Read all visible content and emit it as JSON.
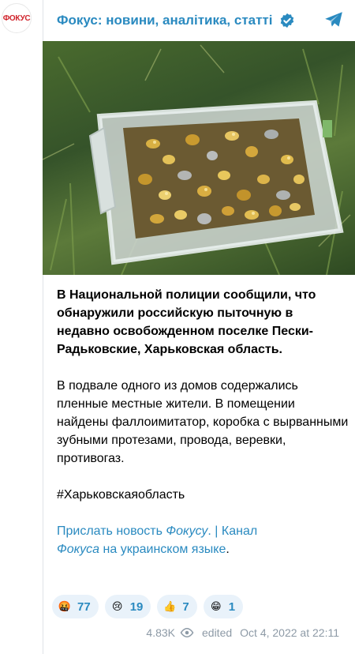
{
  "channel": {
    "avatar_label": "ФОКУС",
    "name": "Фокус: новини, аналітика, статті"
  },
  "post": {
    "paragraph1": "В Национальной полиции сообщили, что обнаружили российскую пыточную в недавно освобожденном поселке Пески-Радьковские, Харьковская область.",
    "paragraph2": "В подвале одного из домов содержались пленные местные жители. В помещении найдены фаллоимитатор, коробка с вырванными зубными протезами, провода, веревки, противогаз.",
    "hashtag": "#Харьковскаяобласть",
    "footer": {
      "part1": "Прислать новость ",
      "part1_italic": "Фокусу",
      "part1_end": ".",
      "separator": " | ",
      "part2": "Канал",
      "part2_italic": "Фокуса",
      "part2_end": "на украинском языке",
      "end": "."
    }
  },
  "reactions": [
    {
      "icon": "angry-face-icon",
      "emoji": "🤬",
      "count": "77"
    },
    {
      "icon": "crying-face-icon",
      "emoji": "😢",
      "count": "19"
    },
    {
      "icon": "thumbs-up-icon",
      "emoji": "👍",
      "count": "7"
    },
    {
      "icon": "grinning-face-icon",
      "emoji": "😁",
      "count": "1"
    }
  ],
  "meta": {
    "views": "4.83K",
    "edited": "edited",
    "datetime": "Oct 4, 2022 at 22:11"
  },
  "colors": {
    "link": "#2a8ac0",
    "reaction_bg": "#e9f2fa",
    "meta": "#8d9aa6",
    "brand_red": "#d0232b"
  }
}
